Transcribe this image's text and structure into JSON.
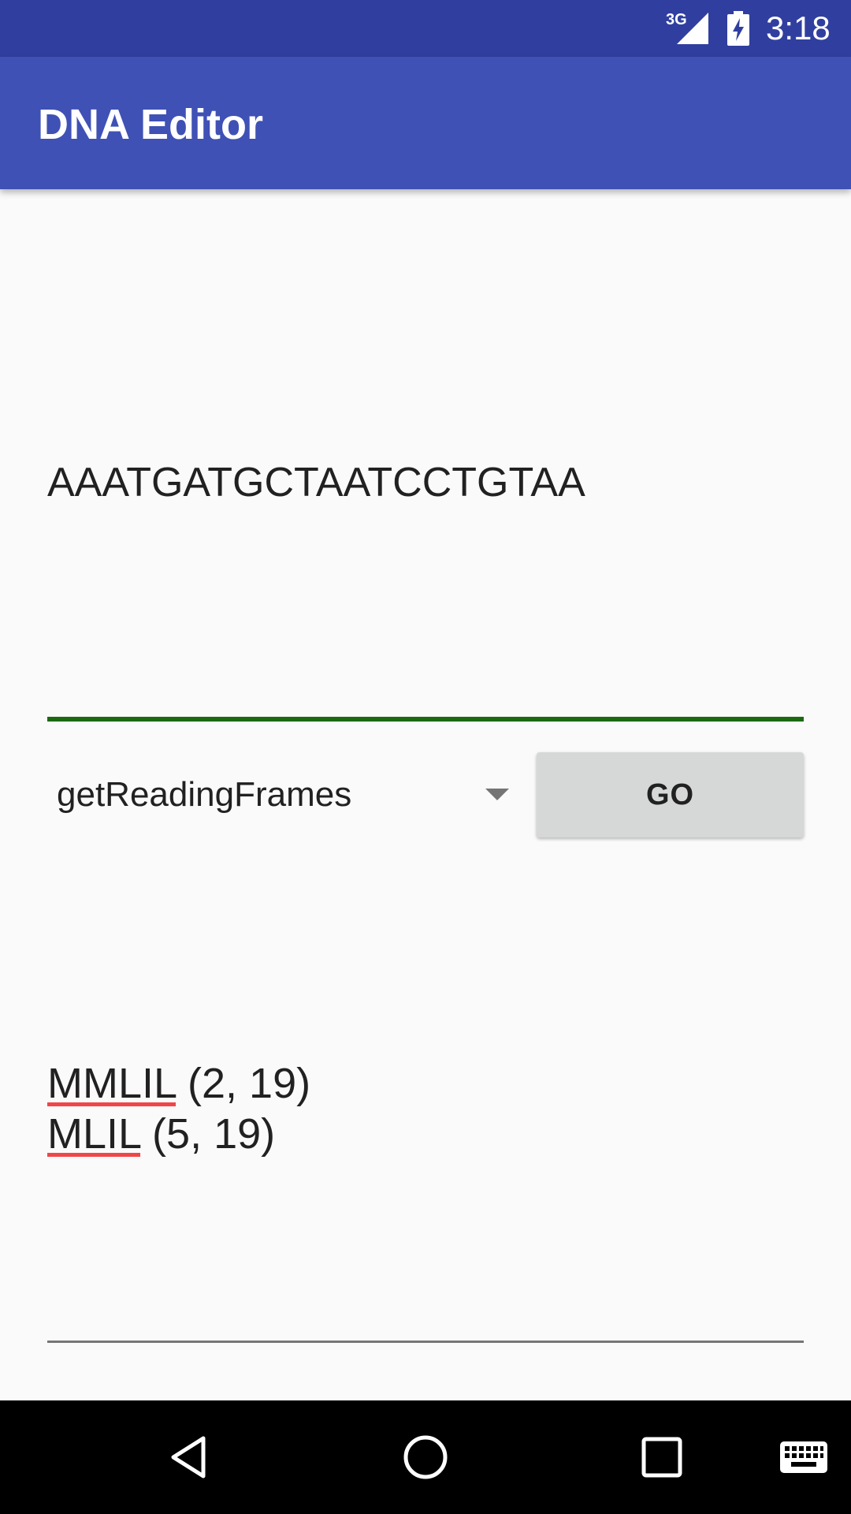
{
  "status_bar": {
    "network": "3G",
    "time": "3:18",
    "icons": [
      "signal-icon",
      "battery-charging-icon"
    ]
  },
  "app_bar": {
    "title": "DNA Editor"
  },
  "dna_input": {
    "value": "AAATGATGCTAATCCTGTAA"
  },
  "operation_spinner": {
    "selected": "getReadingFrames"
  },
  "go_button": {
    "label": "GO"
  },
  "results": {
    "lines": [
      {
        "protein": "MMLIL",
        "range": " (2, 19)"
      },
      {
        "protein": "MLIL",
        "range": " (5, 19)"
      }
    ]
  },
  "nav_bar": {
    "icons": [
      "back-icon",
      "home-icon",
      "recents-icon",
      "keyboard-icon"
    ]
  },
  "colors": {
    "status_bar": "#303F9F",
    "app_bar": "#3F51B5",
    "background": "#FAFAFA",
    "input_underline_active": "#1B6A12",
    "spell_underline": "#F0464A",
    "button": "#D6D7D7"
  }
}
